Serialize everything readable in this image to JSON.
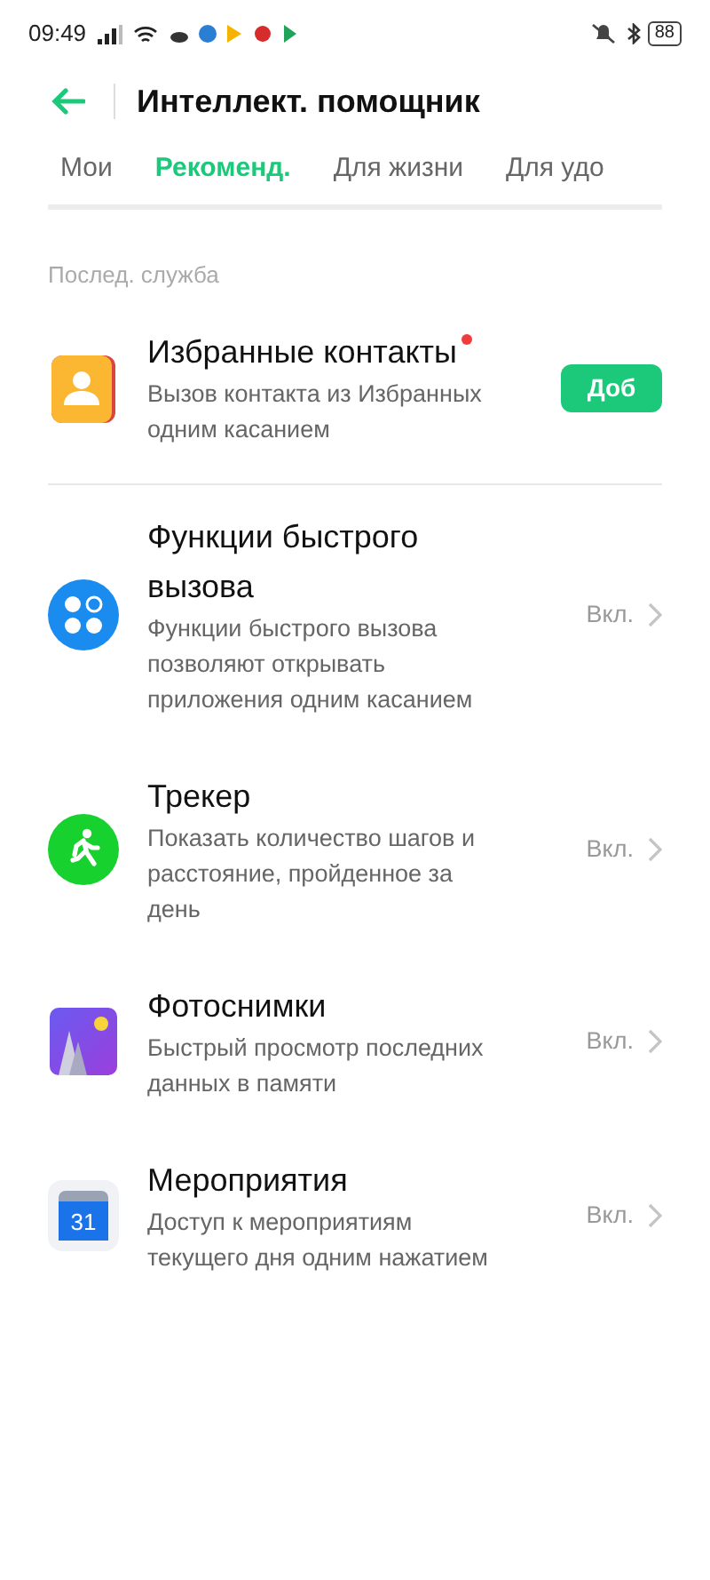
{
  "status_bar": {
    "time": "09:49",
    "battery": "88"
  },
  "header": {
    "title": "Интеллект. помощник"
  },
  "tabs": [
    {
      "label": "Мои",
      "selected": false
    },
    {
      "label": "Рекоменд.",
      "selected": true
    },
    {
      "label": "Для жизни",
      "selected": false
    },
    {
      "label": "Для удо",
      "selected": false
    }
  ],
  "section": {
    "title": "Послед. служба"
  },
  "items": [
    {
      "kind": "add",
      "title": "Избранные контакты",
      "new": true,
      "description": "Вызов контакта из Избранных одним касанием",
      "action": "Доб"
    },
    {
      "kind": "status",
      "title": "Функции быстрого вызова",
      "new": false,
      "description": "Функции быстрого вызова позволяют открывать приложения одним касанием",
      "action": "Вкл."
    },
    {
      "kind": "status",
      "title": "Трекер",
      "new": false,
      "description": "Показать количество шагов и расстояние, пройденное за день",
      "action": "Вкл."
    },
    {
      "kind": "status",
      "title": "Фотоснимки",
      "new": false,
      "description": "Быстрый просмотр последних данных в памяти",
      "action": "Вкл."
    },
    {
      "kind": "status",
      "icon_label": "31",
      "title": "Мероприятия",
      "new": false,
      "description": "Доступ к мероприятиям текущего дня одним нажатием",
      "action": "Вкл."
    }
  ]
}
